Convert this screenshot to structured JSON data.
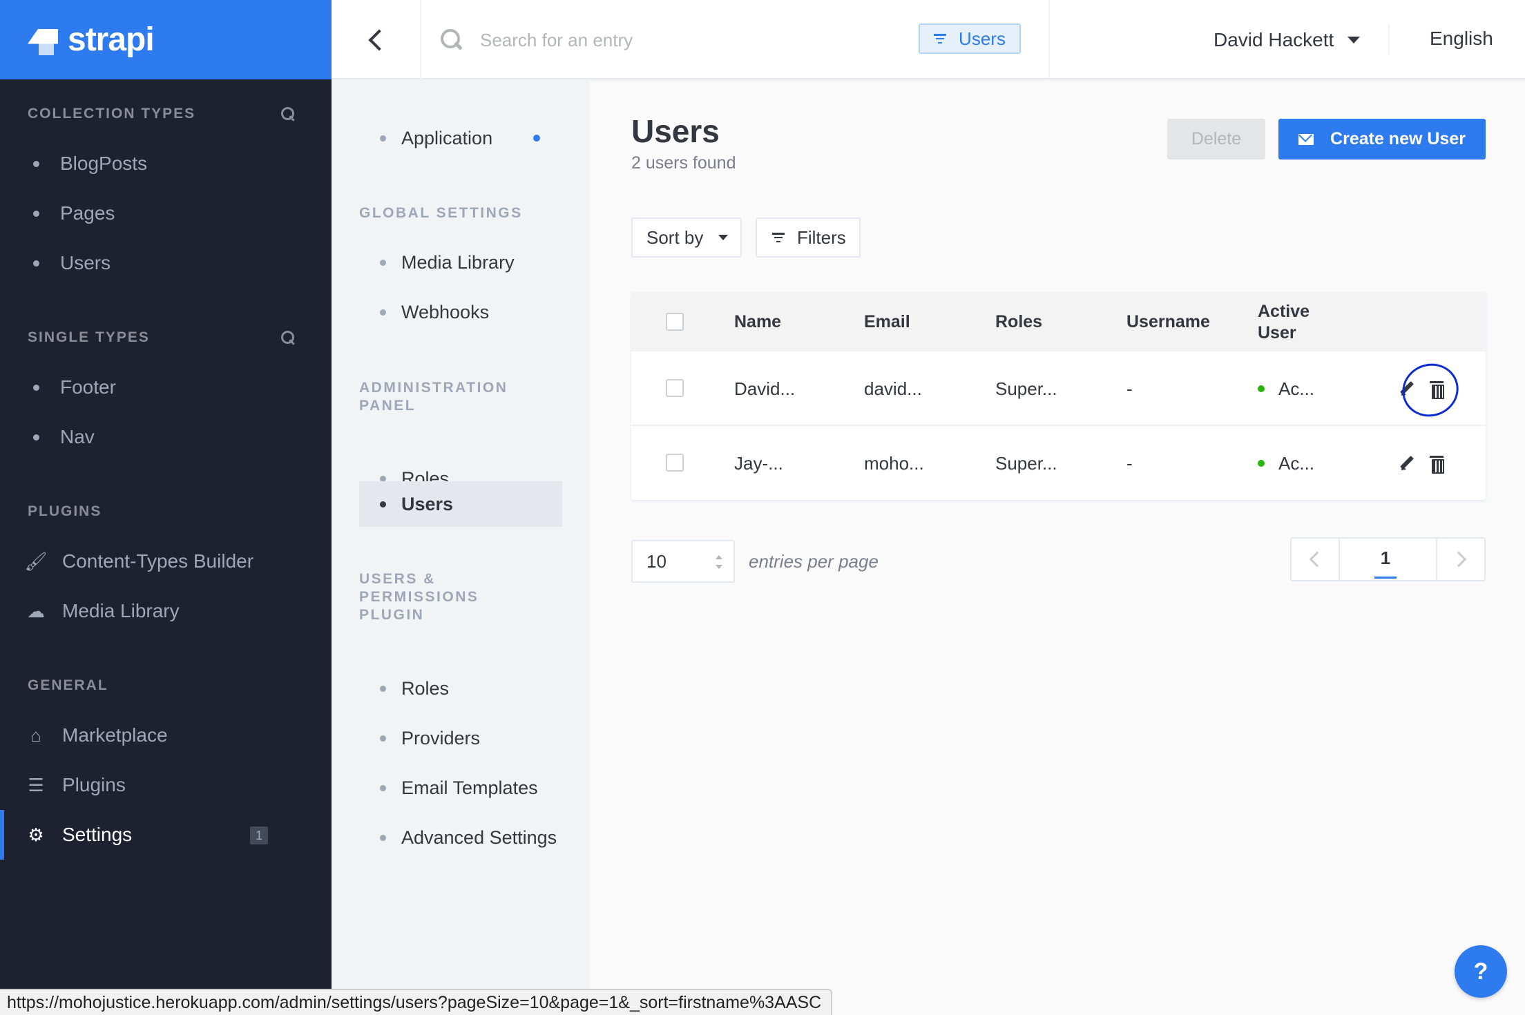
{
  "brand": {
    "name": "strapi"
  },
  "sidebar": {
    "sections": [
      {
        "title": "Collection Types",
        "items": [
          "BlogPosts",
          "Pages",
          "Users"
        ]
      },
      {
        "title": "Single Types",
        "items": [
          "Footer",
          "Nav"
        ]
      },
      {
        "title": "Plugins",
        "items": [
          {
            "label": "Content-Types Builder",
            "icon": "paintbrush-icon"
          },
          {
            "label": "Media Library",
            "icon": "cloud-upload-icon"
          }
        ]
      },
      {
        "title": "General",
        "items": [
          {
            "label": "Marketplace",
            "icon": "basket-icon"
          },
          {
            "label": "Plugins",
            "icon": "list-icon"
          },
          {
            "label": "Settings",
            "icon": "gear-icon",
            "active": true,
            "badge": "1"
          }
        ]
      }
    ]
  },
  "header": {
    "search_placeholder": "Search for an entry",
    "context_filter": "Users",
    "user_name": "David Hackett",
    "language": "English"
  },
  "settings_nav": {
    "application": "Application",
    "global_title": "Global Settings",
    "global_items": [
      "Media Library",
      "Webhooks"
    ],
    "admin_title": "Administration Panel",
    "admin_items": [
      "Roles",
      "Users"
    ],
    "up_title": "Users & Permissions Plugin",
    "up_items": [
      "Roles",
      "Providers",
      "Email Templates",
      "Advanced Settings"
    ]
  },
  "main": {
    "title": "Users",
    "subtitle": "2 users found",
    "delete_label": "Delete",
    "create_label": "Create new User",
    "sort_label": "Sort by",
    "filters_label": "Filters",
    "columns": [
      "Name",
      "Email",
      "Roles",
      "Username",
      "Active User"
    ],
    "rows": [
      {
        "name": "David...",
        "email": "david...",
        "roles": "Super...",
        "username": "-",
        "active": "Ac..."
      },
      {
        "name": "Jay-...",
        "email": "moho...",
        "roles": "Super...",
        "username": "-",
        "active": "Ac..."
      }
    ],
    "page_size": "10",
    "per_page_label": "entries per page",
    "current_page": "1"
  },
  "help": "?",
  "status_url": "https://mohojustice.herokuapp.com/admin/settings/users?pageSize=10&page=1&_sort=firstname%3AASC",
  "colors": {
    "accent": "#2e7bf0",
    "sidebar_bg": "#1d2130",
    "active_status": "#27b70a",
    "annotation": "#0c2bd1"
  }
}
